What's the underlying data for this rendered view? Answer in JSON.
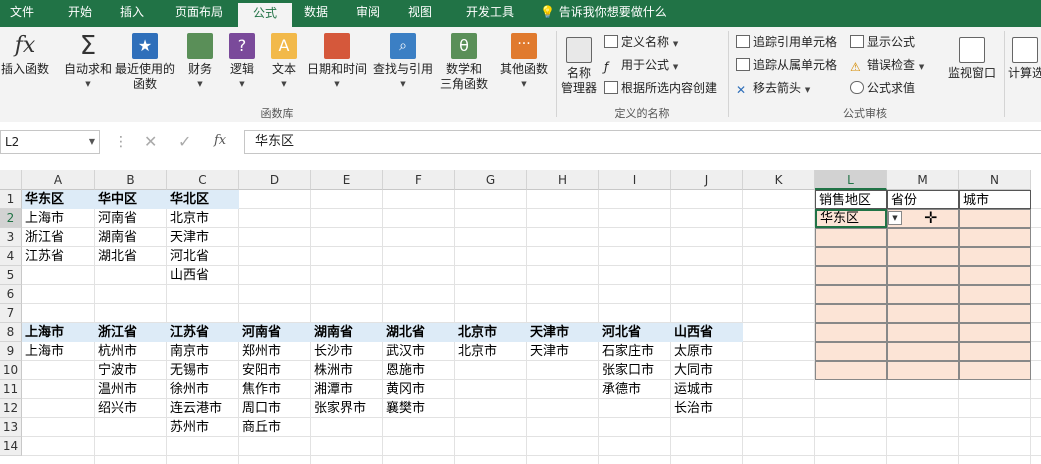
{
  "ribbon_tabs": [
    "文件",
    "开始",
    "插入",
    "页面布局",
    "公式",
    "数据",
    "审阅",
    "视图",
    "开发工具"
  ],
  "tell_me": "告诉我你想要做什么",
  "groups": {
    "function_library": "函数库",
    "defined_names": "定义的名称",
    "formula_auditing": "公式审核"
  },
  "buttons": {
    "insert_function": "插入函数",
    "autosum": "自动求和",
    "recent": "最近使用的\n函数",
    "financial": "财务",
    "logical": "逻辑",
    "text": "文本",
    "datetime": "日期和时间",
    "lookup": "查找与引用",
    "math": "数学和\n三角函数",
    "more": "其他函数",
    "name_manager": "名称\n管理器",
    "define_name": "定义名称",
    "use_in_formula": "用于公式",
    "create_from_selection": "根据所选内容创建",
    "trace_precedents": "追踪引用单元格",
    "trace_dependents": "追踪从属单元格",
    "remove_arrows": "移去箭头",
    "show_formulas": "显示公式",
    "error_checking": "错误检查",
    "evaluate_formula": "公式求值",
    "watch_window": "监视窗口",
    "calc_options": "计算选"
  },
  "formula_bar": {
    "name_box": "L2",
    "fx": "fx",
    "content": "华东区"
  },
  "columns": [
    "A",
    "B",
    "C",
    "D",
    "E",
    "F",
    "G",
    "H",
    "I",
    "J",
    "K",
    "L",
    "M",
    "N"
  ],
  "rows": [
    "1",
    "2",
    "3",
    "4",
    "5",
    "6",
    "7",
    "8",
    "9",
    "10",
    "11",
    "12",
    "13",
    "14"
  ],
  "sheet": {
    "region_headers": [
      "华东区",
      "华中区",
      "华北区"
    ],
    "regions": [
      [
        "上海市",
        "浙江省",
        "江苏省"
      ],
      [
        "河南省",
        "湖南省",
        "湖北省"
      ],
      [
        "北京市",
        "天津市",
        "河北省",
        "山西省"
      ]
    ],
    "province_headers": [
      "上海市",
      "浙江省",
      "江苏省",
      "河南省",
      "湖南省",
      "湖北省",
      "北京市",
      "天津市",
      "河北省",
      "山西省"
    ],
    "cities": [
      [
        "上海市"
      ],
      [
        "杭州市",
        "宁波市",
        "温州市",
        "绍兴市"
      ],
      [
        "南京市",
        "无锡市",
        "徐州市",
        "连云港市",
        "苏州市"
      ],
      [
        "郑州市",
        "安阳市",
        "焦作市",
        "周口市",
        "商丘市"
      ],
      [
        "长沙市",
        "株洲市",
        "湘潭市",
        "张家界市"
      ],
      [
        "武汉市",
        "恩施市",
        "黄冈市",
        "襄樊市"
      ],
      [
        "北京市"
      ],
      [
        "天津市"
      ],
      [
        "石家庄市",
        "张家口市",
        "承德市"
      ],
      [
        "太原市",
        "大同市",
        "运城市",
        "长治市"
      ]
    ],
    "form_headers": [
      "销售地区",
      "省份",
      "城市"
    ],
    "form_value": "华东区"
  },
  "colors": {
    "excel_green": "#217346",
    "header_fill": "#ddebf7",
    "input_fill": "#fce4d6"
  }
}
